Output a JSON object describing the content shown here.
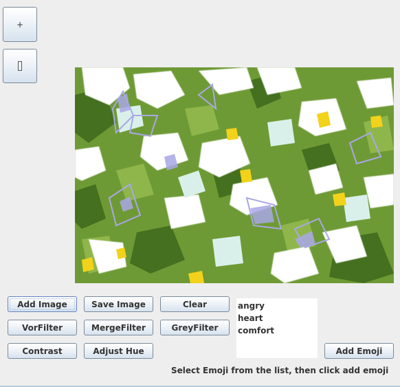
{
  "side_buttons": {
    "plus_label": "+",
    "second_label": ""
  },
  "image": {
    "description_colors": {
      "grass": "#6e9a35",
      "dark_grass": "#3f6b1d",
      "flower_white": "#ffffff",
      "flower_yellow": "#f2d21a",
      "butterfly_lavender": "#a9a7e6"
    }
  },
  "toolbar": {
    "add_image": "Add Image",
    "save_image": "Save Image",
    "clear": "Clear",
    "vor_filter": "VorFilter",
    "merge_filter": "MergeFilter",
    "grey_filter": "GreyFilter",
    "contrast": "Contrast",
    "adjust_hue": "Adjust Hue"
  },
  "emoji": {
    "items": [
      "angry",
      "heart",
      "comfort"
    ],
    "add_button": "Add Emoji",
    "hint": "Select Emoji from the list, then click add emoji"
  },
  "colors": {
    "window_bg": "#eeeeee",
    "button_text": "#333333",
    "button_border": "#7a8a99"
  }
}
